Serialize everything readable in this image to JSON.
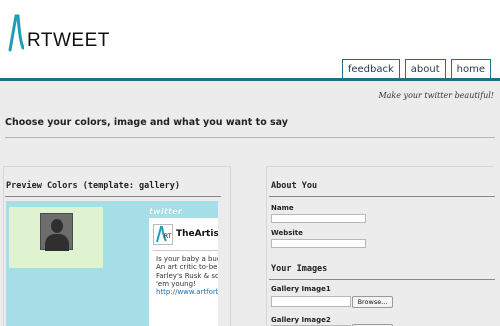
{
  "header": {
    "logo_text": "RTWEET",
    "nav": [
      {
        "label": "feedback"
      },
      {
        "label": "about"
      },
      {
        "label": "home"
      }
    ],
    "tagline": "Make your twitter beautiful!"
  },
  "page": {
    "heading": "Choose your colors, image and what you want to say"
  },
  "preview": {
    "title": "Preview Colors (template: gallery)",
    "twitter_wordmark": "twitter",
    "tweet": {
      "username": "TheArtist",
      "lines": [
        "Is your baby a budc",
        "An art critic to-be?",
        "Farley's Rusk & son",
        "'em young!"
      ],
      "link": "http://www.artforb"
    }
  },
  "form": {
    "about_title": "About You",
    "name_label": "Name",
    "name_value": "",
    "website_label": "Website",
    "website_value": "",
    "images_title": "Your Images",
    "gallery1_label": "Gallery Image1",
    "gallery2_label": "Gallery Image2",
    "browse_label": "Browse..."
  },
  "colors": {
    "accent": "#1f6f8b",
    "preview_background": "#a7dfe8",
    "profile_background": "#dff3d0",
    "page_background": "#ececec"
  }
}
